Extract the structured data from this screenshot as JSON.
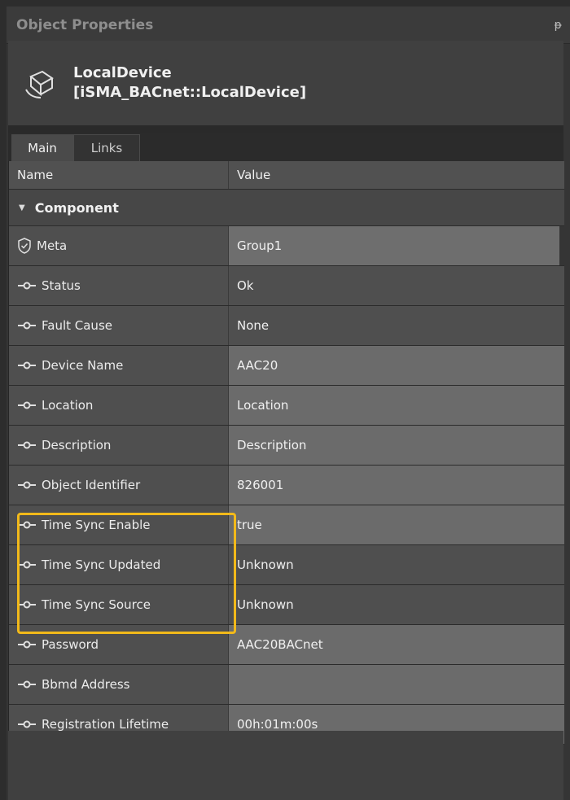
{
  "panel": {
    "title": "Object Properties",
    "pin_glyph": "ᵽ"
  },
  "header": {
    "icon": "device-icon",
    "name": "LocalDevice",
    "type": "[iSMA_BACnet::LocalDevice]"
  },
  "tabs": {
    "main": "Main",
    "links": "Links"
  },
  "table": {
    "col_name": "Name",
    "col_value": "Value",
    "group": "Component",
    "rows": [
      {
        "name": "Meta",
        "value": "Group1"
      },
      {
        "name": "Status",
        "value": "Ok"
      },
      {
        "name": "Fault Cause",
        "value": "None"
      },
      {
        "name": "Device Name",
        "value": "AAC20"
      },
      {
        "name": "Location",
        "value": "Location"
      },
      {
        "name": "Description",
        "value": "Description"
      },
      {
        "name": "Object Identifier",
        "value": "826001"
      },
      {
        "name": "Time Sync Enable",
        "value": "true"
      },
      {
        "name": "Time Sync Updated",
        "value": "Unknown"
      },
      {
        "name": "Time Sync Source",
        "value": "Unknown"
      },
      {
        "name": "Password",
        "value": "AAC20BACnet"
      },
      {
        "name": "Bbmd Address",
        "value": ""
      },
      {
        "name": "Registration Lifetime",
        "value": "00h:01m:00s"
      }
    ]
  },
  "colors": {
    "highlight": "#f2b91a",
    "background": "#2d2d2d"
  }
}
